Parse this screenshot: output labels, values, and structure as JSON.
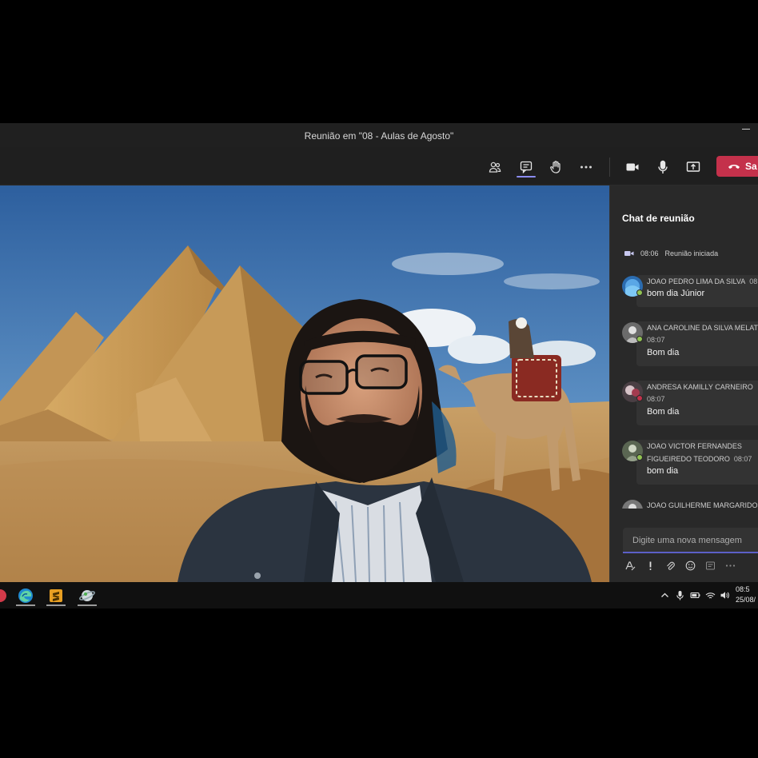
{
  "window": {
    "title": "Reunião em \"08 - Aulas de Agosto\""
  },
  "toolbar": {
    "icons": [
      "participants-icon",
      "chat-icon",
      "raise-hand-icon",
      "more-options-icon",
      "camera-icon",
      "microphone-icon",
      "share-screen-icon"
    ],
    "leave_label": "Sa",
    "leave_color": "#c4314b",
    "active_indicator_color": "#8b8cf0"
  },
  "chat": {
    "title": "Chat de reunião",
    "meeting_started": {
      "time": "08:06",
      "label": "Reunião iniciada"
    },
    "messages": [
      {
        "sender": "JOAO PEDRO LIMA DA SILVA",
        "time": "08",
        "text": "bom dia Júnior",
        "presence": "#92c353"
      },
      {
        "sender": "ANA CAROLINE DA SILVA MELATO",
        "time": "08:07",
        "text": "Bom dia",
        "presence": "#92c353"
      },
      {
        "sender": "ANDRESA KAMILLY CARNEIRO",
        "time": "08:07",
        "text": "Bom dia",
        "presence": "#c4314b"
      },
      {
        "sender_line1": "JOAO VICTOR FERNANDES",
        "sender_line2": "FIGUEIREDO TEODORO",
        "time": "08:07",
        "text": "bom dia",
        "presence": "#92c353"
      },
      {
        "sender": "JOAO GUILHERME MARGARIDO"
      }
    ],
    "compose_placeholder": "Digite uma nova mensagem",
    "compose_tools": [
      "format-icon",
      "important-icon",
      "attach-icon",
      "emoji-icon",
      "sticker-icon",
      "more-icon"
    ]
  },
  "taskbar": {
    "apps": [
      "app-red-icon",
      "edge-icon",
      "sublime-text-icon",
      "app-globe-icon"
    ],
    "tray": [
      "chevron-up-icon",
      "microphone-icon",
      "battery-icon",
      "wifi-icon",
      "volume-icon"
    ],
    "time": "08:5",
    "date": "25/08/"
  }
}
